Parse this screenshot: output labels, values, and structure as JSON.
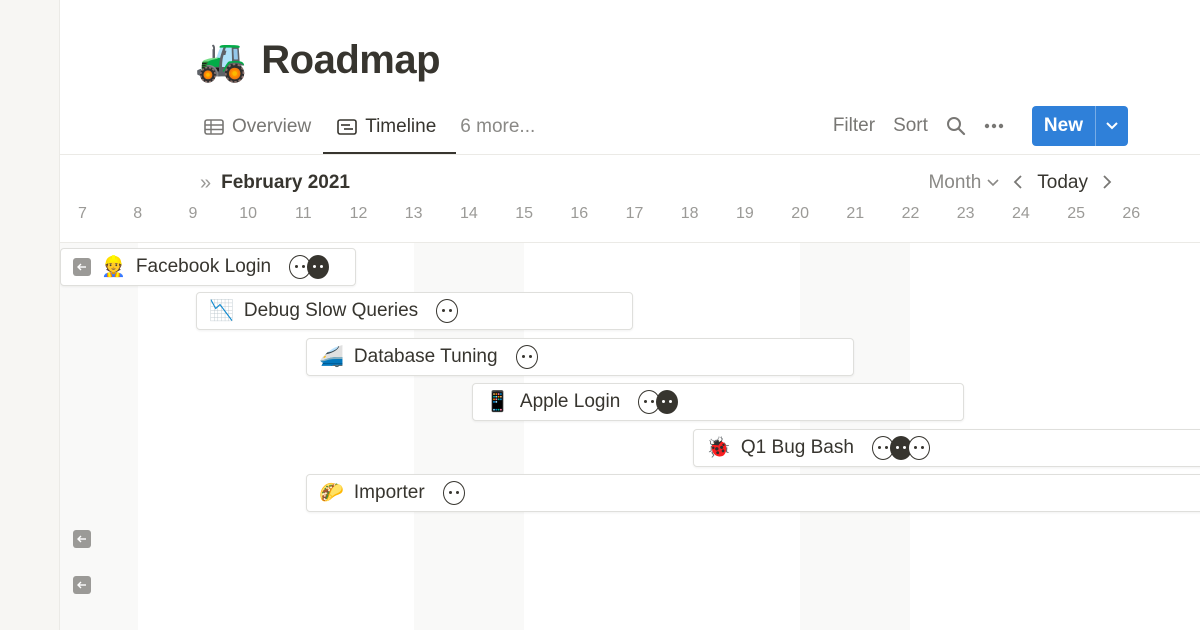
{
  "page": {
    "emoji": "🚜",
    "title": "Roadmap"
  },
  "views": {
    "items": [
      {
        "label": "Overview",
        "icon": "table-icon",
        "active": false
      },
      {
        "label": "Timeline",
        "icon": "timeline-icon",
        "active": true
      }
    ],
    "more": "6 more..."
  },
  "toolbar": {
    "filter": "Filter",
    "sort": "Sort",
    "new_label": "New"
  },
  "timeline": {
    "month_label": "February 2021",
    "scale_label": "Month",
    "today_label": "Today",
    "days": [
      "7",
      "8",
      "9",
      "10",
      "11",
      "12",
      "13",
      "14",
      "15",
      "16",
      "17",
      "18",
      "19",
      "20",
      "21",
      "22",
      "23",
      "24",
      "25",
      "26"
    ]
  },
  "tasks": [
    {
      "emoji": "👷",
      "name": "Facebook Login",
      "avatars": 2,
      "offscreen_left": true
    },
    {
      "emoji": "📉",
      "name": "Debug Slow Queries",
      "avatars": 1
    },
    {
      "emoji": "🚄",
      "name": "Database Tuning",
      "avatars": 1
    },
    {
      "emoji": "📱",
      "name": "Apple Login",
      "avatars": 2
    },
    {
      "emoji": "🐞",
      "name": "Q1 Bug Bash",
      "avatars": 3
    },
    {
      "emoji": "🌮",
      "name": "Importer",
      "avatars": 1
    }
  ],
  "colors": {
    "accent": "#2f80d9",
    "text": "#37352f",
    "muted": "#787774"
  }
}
